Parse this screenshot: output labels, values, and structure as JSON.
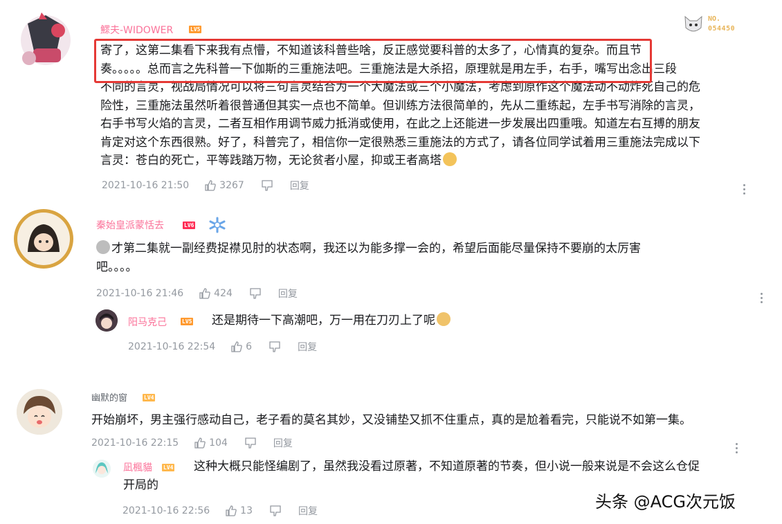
{
  "comments": [
    {
      "user": "鰥夫-WIDOWER",
      "level": "LV5",
      "fan_badge": {
        "label": "NO.",
        "number": "054450"
      },
      "lines": [
        "寄了，这第二集看下来我有点懵，不知道该科普些啥，反正感觉要科普的太多了，心情真的复杂。而且节",
        "奏。。。。。总而言之先科普一下伽斯的三重施法吧。三重施法是大杀招，原理就是用左手，右手，嘴写出念出三段",
        "不同的言灵，视战局情况可以将三句言灵结合为一个大魔法或三个小魔法，考虑到原作这个魔法动不动炸死自己的危",
        "险性，三重施法虽然听着很普通但其实一点也不简单。但训练方法很简单的，先从二重练起，左手书写消除的言灵，",
        "右手书写火焰的言灵，二者互相作用调节威力抵消或使用，在此之上还能进一步发展出四重哦。知道左右互搏的朋友",
        "肯定对这个东西很熟。好了，科普完了，相信你一定很熟悉三重施法的方式了，请各位同学试着用三重施法完成以下",
        "言灵：苍白的死亡，平等践踏万物，无论贫者小屋，抑或王者高塔"
      ],
      "time": "2021-10-16 21:50",
      "likes": "3267",
      "reply": "回复"
    },
    {
      "user": "秦始皇派蒙恬去",
      "level": "LV6",
      "lines": [
        "才第二集就一副经费捉襟见肘的状态啊，我还以为能多撑一会的，希望后面能尽量保持不要崩的太厉害",
        "吧。。。。"
      ],
      "time": "2021-10-16 21:46",
      "likes": "424",
      "reply": "回复",
      "replies": [
        {
          "user": "阳马克己",
          "level": "LV5",
          "text": "还是期待一下高潮吧，万一用在刀刃上了呢",
          "time": "2021-10-16 22:54",
          "likes": "6",
          "reply": "回复"
        }
      ]
    },
    {
      "user": "幽默的窗",
      "level": "LV4",
      "lines": [
        "开始崩坏，男主强行感动自己，老子看的莫名其妙，又没铺垫又抓不住重点，真的是尬着看完，只能说不如第一集。"
      ],
      "time": "2021-10-16 22:15",
      "likes": "104",
      "reply": "回复",
      "replies": [
        {
          "user": "凪楓貓",
          "level": "LV4",
          "lines": [
            "这种大概只能怪编剧了，虽然我没看过原著，不知道原著的节奏，但小说一般来说是不会这么仓促",
            "开局的"
          ],
          "time": "2021-10-16 22:56",
          "likes": "13",
          "reply": "回复"
        }
      ]
    }
  ],
  "watermark": "头条 @ACG次元饭",
  "colors": {
    "username_pink": "#fb7299",
    "highlight_red": "#e53935",
    "meta_gray": "#9499a0"
  }
}
